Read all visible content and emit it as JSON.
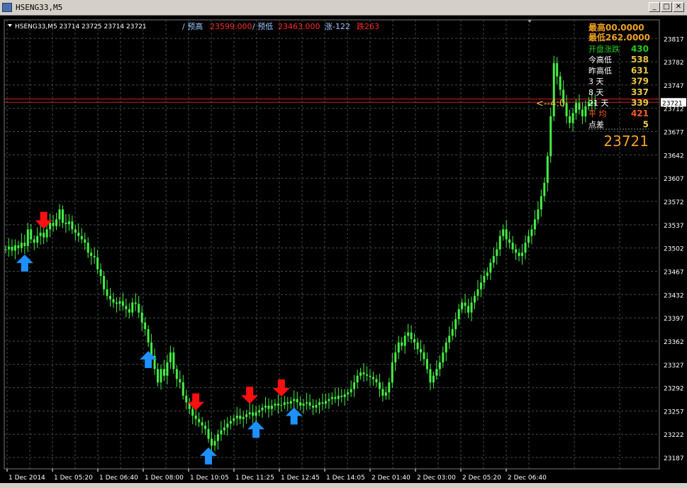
{
  "window": {
    "title": "HSENG33,M5",
    "min_glyph": "_",
    "restore_glyph": "□",
    "close_glyph": "✕"
  },
  "header": {
    "symbol_line": "HSENG33,M5  23714 23725 23714 23721",
    "pred_high_label": "/ 预高",
    "pred_high_value": "23599.000",
    "pred_low_label": "/ 预低",
    "pred_low_value": "23463.000",
    "rise_label": "涨-122",
    "fall_label": "跌263"
  },
  "info_panel": {
    "line1": "最高00.0000",
    "line2": "最低262.0000",
    "rows": [
      {
        "label": "开盘涨跌",
        "value": "430",
        "label_color": "#22cc22",
        "value_color": "#22cc22"
      },
      {
        "label": "今高低",
        "value": "538",
        "label_color": "#ffffff",
        "value_color": "#e8c840"
      },
      {
        "label": "昨高低",
        "value": "631",
        "label_color": "#ffffff",
        "value_color": "#e8c840"
      },
      {
        "label": "3   天",
        "value": "379",
        "label_color": "#ffffff",
        "value_color": "#e8c840"
      },
      {
        "label": "8   天",
        "value": "337",
        "label_color": "#ffffff",
        "value_color": "#e8c840"
      },
      {
        "label": "21  天",
        "value": "339",
        "label_color": "#ffffff",
        "value_color": "#e8c840"
      },
      {
        "label": "平   均",
        "value": "421",
        "label_color": "#ff5a1e",
        "value_color": "#ff5a1e"
      },
      {
        "label": "点差",
        "value": "5",
        "label_color": "#ffffff",
        "value_color": "#e8c840"
      }
    ],
    "big_price": "23721",
    "arrow_note": "<--4:0"
  },
  "colors": {
    "background": "#000000",
    "grid": "#3c4a4a",
    "candle": "#44ee44",
    "up_arrow": "#1e90ff",
    "down_arrow": "#ff1010",
    "price_line": "#cc2222",
    "axis_text": "#ffffff",
    "gold": "#f0a020"
  },
  "chart_data": {
    "type": "candlestick",
    "title": "HSENG33,M5",
    "ylim": [
      23170,
      23845
    ],
    "y_ticks": [
      23817,
      23782,
      23747,
      23712,
      23677,
      23642,
      23607,
      23572,
      23537,
      23502,
      23467,
      23432,
      23397,
      23362,
      23327,
      23292,
      23257,
      23222,
      23187
    ],
    "x_tick_labels": [
      "1 Dec 2014",
      "1 Dec 05:20",
      "1 Dec 06:40",
      "1 Dec 08:00",
      "1 Dec 10:05",
      "1 Dec 11:25",
      "1 Dec 12:45",
      "1 Dec 14:05",
      "2 Dec 01:40",
      "2 Dec 03:00",
      "2 Dec 05:20",
      "2 Dec 06:40"
    ],
    "grid": true,
    "current_price": 23721,
    "current_price_label": "23721",
    "price_line_levels": [
      23726,
      23721
    ],
    "series": [
      {
        "close": [
          23500,
          23504,
          23498,
          23506,
          23502,
          23510,
          23505,
          23530,
          23515,
          23510,
          23520,
          23525,
          23518,
          23530,
          23540,
          23535,
          23545,
          23560,
          23540,
          23538,
          23542,
          23530,
          23525,
          23520,
          23515,
          23510,
          23495,
          23490,
          23488,
          23470,
          23460,
          23440,
          23430,
          23425,
          23420,
          23418,
          23422,
          23415,
          23410,
          23405,
          23420,
          23418,
          23405,
          23390,
          23380,
          23360,
          23340,
          23320,
          23300,
          23320,
          23310,
          23330,
          23345,
          23320,
          23305,
          23300,
          23280,
          23270,
          23260,
          23250,
          23245,
          23240,
          23235,
          23230,
          23215,
          23205,
          23212,
          23222,
          23228,
          23232,
          23238,
          23242,
          23246,
          23250,
          23245,
          23248,
          23252,
          23255,
          23250,
          23255,
          23258,
          23262,
          23265,
          23260,
          23265,
          23268,
          23265,
          23266,
          23270,
          23268,
          23272,
          23275,
          23270,
          23265,
          23268,
          23270,
          23265,
          23262,
          23266,
          23270,
          23268,
          23272,
          23275,
          23278,
          23275,
          23280,
          23278,
          23282,
          23285,
          23290,
          23300,
          23310,
          23315,
          23312,
          23310,
          23308,
          23305,
          23300,
          23290,
          23280,
          23285,
          23300,
          23330,
          23345,
          23360,
          23355,
          23370,
          23375,
          23365,
          23360,
          23350,
          23345,
          23335,
          23320,
          23300,
          23310,
          23320,
          23330,
          23345,
          23360,
          23370,
          23380,
          23395,
          23410,
          23420,
          23415,
          23405,
          23420,
          23430,
          23440,
          23450,
          23460,
          23465,
          23480,
          23490,
          23500,
          23520,
          23530,
          23515,
          23510,
          23500,
          23495,
          23490,
          23495,
          23510,
          23520,
          23530,
          23545,
          23560,
          23580,
          23600,
          23640,
          23700,
          23780,
          23760,
          23740,
          23720,
          23700,
          23690,
          23705,
          23720,
          23710,
          23700,
          23715,
          23722,
          23718,
          23721
        ]
      }
    ],
    "signals": [
      {
        "type": "up",
        "index": 6
      },
      {
        "type": "down",
        "index": 12
      },
      {
        "type": "up",
        "index": 45
      },
      {
        "type": "down",
        "index": 60
      },
      {
        "type": "up",
        "index": 64
      },
      {
        "type": "down",
        "index": 77
      },
      {
        "type": "up",
        "index": 79
      },
      {
        "type": "down",
        "index": 87
      },
      {
        "type": "up",
        "index": 91
      }
    ]
  }
}
